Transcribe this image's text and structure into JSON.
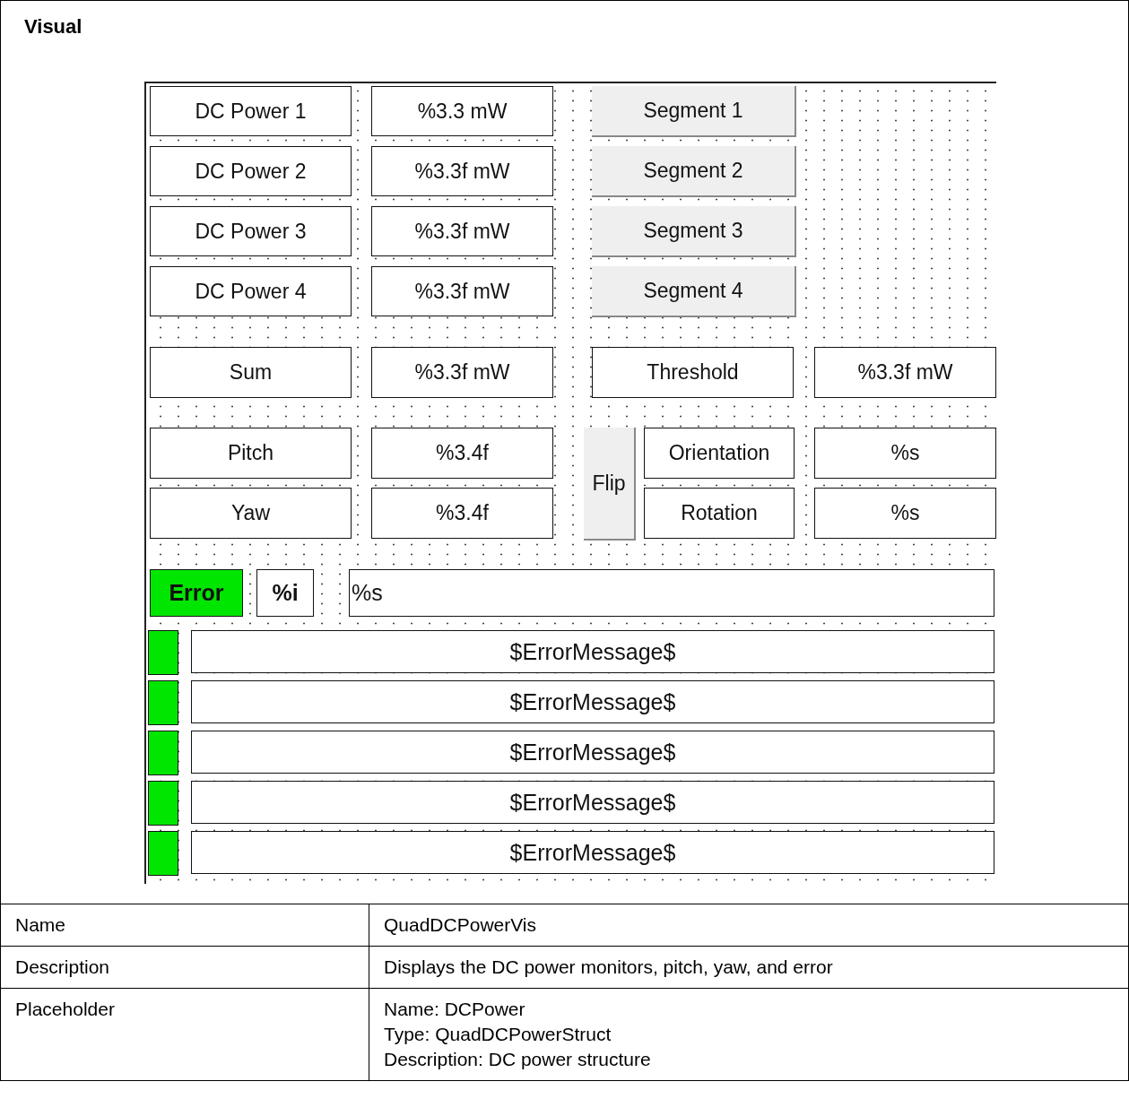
{
  "section_title": "Visual",
  "visualization": {
    "power_rows": [
      {
        "label": "DC Power 1",
        "value": "%3.3 mW",
        "button": "Segment 1"
      },
      {
        "label": "DC Power 2",
        "value": "%3.3f mW",
        "button": "Segment 2"
      },
      {
        "label": "DC Power 3",
        "value": "%3.3f mW",
        "button": "Segment 3"
      },
      {
        "label": "DC Power 4",
        "value": "%3.3f mW",
        "button": "Segment 4"
      }
    ],
    "sum": {
      "label": "Sum",
      "value": "%3.3f mW"
    },
    "threshold": {
      "label": "Threshold",
      "value": "%3.3f mW"
    },
    "angles": [
      {
        "label": "Pitch",
        "value": "%3.4f"
      },
      {
        "label": "Yaw",
        "value": "%3.4f"
      }
    ],
    "flip_button": "Flip",
    "orientation_fields": [
      {
        "label": "Orientation",
        "value": "%s"
      },
      {
        "label": "Rotation",
        "value": "%s"
      }
    ],
    "error": {
      "label": "Error",
      "code": "%i",
      "text": "%s"
    },
    "error_messages": [
      "$ErrorMessage$",
      "$ErrorMessage$",
      "$ErrorMessage$",
      "$ErrorMessage$",
      "$ErrorMessage$"
    ]
  },
  "properties": [
    {
      "name": "Name",
      "lines": [
        "QuadDCPowerVis"
      ]
    },
    {
      "name": "Description",
      "lines": [
        "Displays the DC power monitors, pitch, yaw, and error"
      ]
    },
    {
      "name": "Placeholder",
      "lines": [
        "Name: DCPower",
        "Type: QuadDCPowerStruct",
        "Description: DC power structure"
      ]
    }
  ]
}
